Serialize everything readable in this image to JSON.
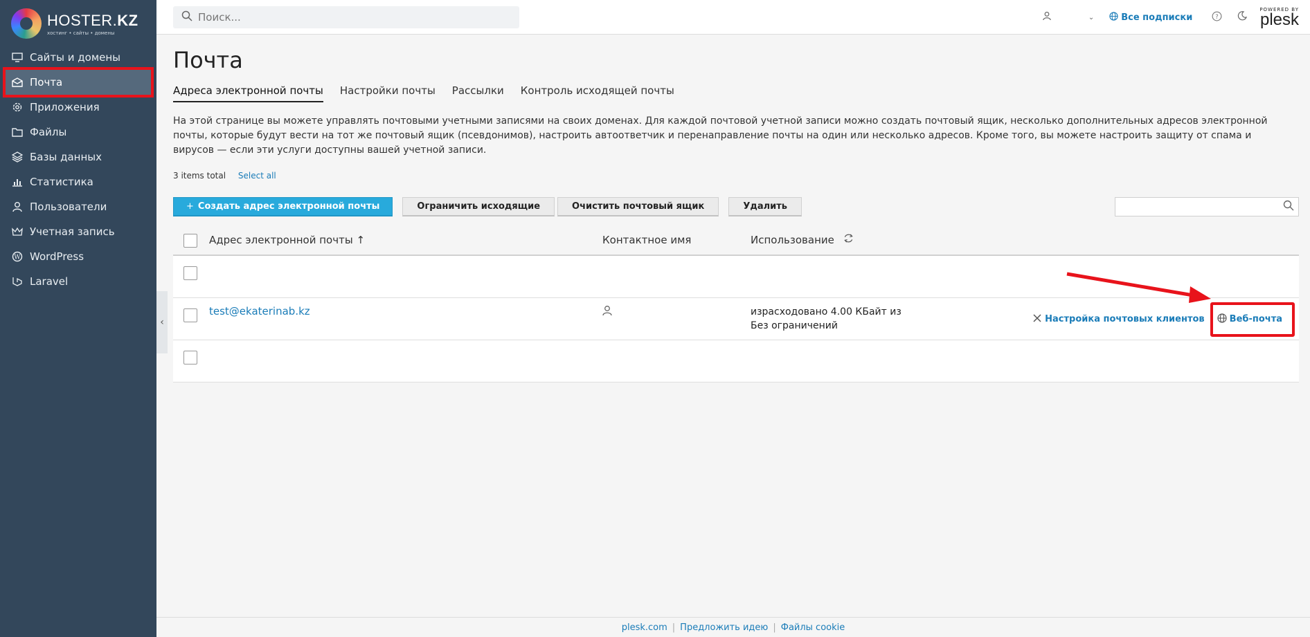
{
  "brand": {
    "name_light": "HOSTER.",
    "name_bold": "KZ",
    "tagline": "хостинг • сайты • домены"
  },
  "sidebar": {
    "items": [
      {
        "label": "Сайты и домены",
        "icon": "monitor-icon"
      },
      {
        "label": "Почта",
        "icon": "mail-icon",
        "active": true
      },
      {
        "label": "Приложения",
        "icon": "gear-icon"
      },
      {
        "label": "Файлы",
        "icon": "folder-icon"
      },
      {
        "label": "Базы данных",
        "icon": "layers-icon"
      },
      {
        "label": "Статистика",
        "icon": "bar-chart-icon"
      },
      {
        "label": "Пользователи",
        "icon": "user-icon"
      },
      {
        "label": "Учетная запись",
        "icon": "crown-icon"
      },
      {
        "label": "WordPress",
        "icon": "wordpress-icon"
      },
      {
        "label": "Laravel",
        "icon": "laravel-icon"
      }
    ]
  },
  "header": {
    "search_placeholder": "Поиск...",
    "subscriptions_label": "Все подписки",
    "powered_by": "POWERED BY",
    "plesk": "plesk"
  },
  "page": {
    "title": "Почта",
    "tabs": [
      "Адреса электронной почты",
      "Настройки почты",
      "Рассылки",
      "Контроль исходящей почты"
    ],
    "description": "На этой странице вы можете управлять почтовыми учетными записями на своих доменах. Для каждой почтовой учетной записи можно создать почтовый ящик, несколько дополнительных адресов электронной почты, которые будут вести на тот же почтовый ящик (псевдонимов), настроить автоответчик и перенаправление почты на один или несколько адресов. Кроме того, вы можете настроить защиту от спама и вирусов — если эти услуги доступны вашей учетной записи.",
    "items_total": "3 items total",
    "select_all": "Select all"
  },
  "toolbar": {
    "create": "Создать адрес электронной почты",
    "limit_outgoing": "Ограничить исходящие",
    "clear_mailbox": "Очистить почтовый ящик",
    "delete": "Удалить"
  },
  "table": {
    "headers": {
      "email": "Адрес электронной почты ↑",
      "contact": "Контактное имя",
      "usage": "Использование"
    },
    "rows": [
      {
        "email": "",
        "usage_line1": "",
        "usage_line2": ""
      },
      {
        "email": "test@ekaterinab.kz",
        "usage_line1": "израсходовано 4.00 КБайт из",
        "usage_line2": "Без ограничений",
        "action_clients": "Настройка почтовых клиентов",
        "action_webmail": "Веб-почта"
      },
      {
        "email": "",
        "usage_line1": "",
        "usage_line2": ""
      }
    ]
  },
  "footer": {
    "link1": "plesk.com",
    "link2": "Предложить идею",
    "link3": "Файлы cookie"
  },
  "colors": {
    "sidebar": "#33475b",
    "accent": "#28aadc",
    "link": "#1a7cb8",
    "highlight": "#e8131b"
  }
}
